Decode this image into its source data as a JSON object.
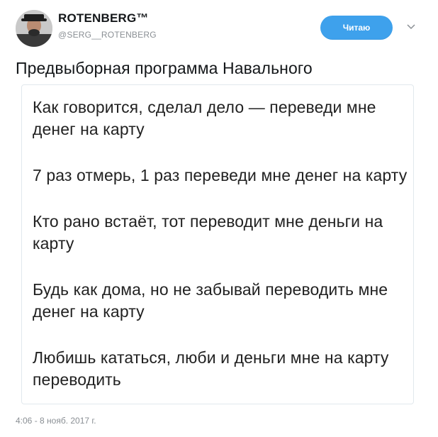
{
  "author": {
    "display_name": "ROTENBERG™",
    "handle": "@SERG__ROTENBERG"
  },
  "follow_button": {
    "label": "Читаю"
  },
  "tweet": {
    "text": "Предвыборная программа Навального",
    "card_lines": [
      "Как говорится, сделал дело — переведи мне денег на карту",
      "7 раз отмерь, 1 раз переведи мне денег на карту",
      "Кто рано встаёт, тот переводит мне деньги на карту",
      "Будь как дома, но не забывай переводить мне денег на карту",
      "Любишь кататься, люби и деньги мне на карту переводить"
    ],
    "timestamp": "4:06 - 8 нояб. 2017 г."
  },
  "icons": {
    "menu": "chevron-down-icon",
    "avatar": "avatar-photo"
  },
  "colors": {
    "accent": "#3ea1ec",
    "text": "#14171a",
    "muted": "#8a8f94",
    "border": "#e1e8ed"
  }
}
